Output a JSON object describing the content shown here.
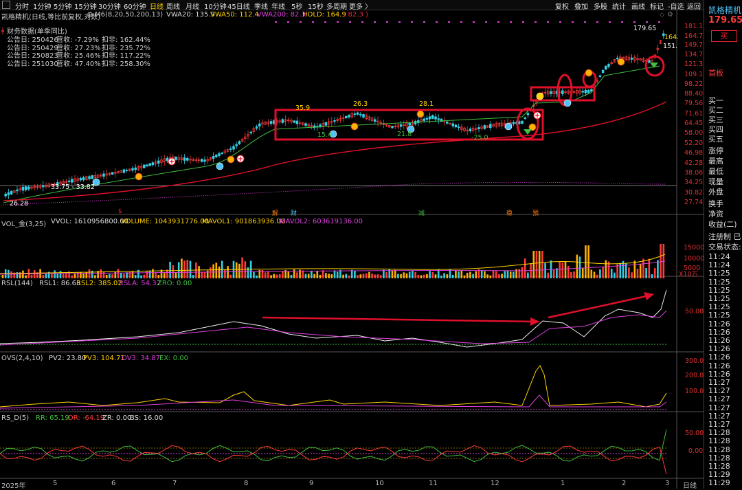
{
  "toolbar": {
    "timeframes": [
      "分时",
      "1分钟",
      "5分钟",
      "15分钟",
      "30分钟",
      "60分钟",
      "日线",
      "周线",
      "月线",
      "10分钟",
      "45日线",
      "季线",
      "年线",
      "5秒",
      "15秒",
      "多周期",
      "更多 〉"
    ],
    "tools": [
      "复权",
      "叠加",
      "多股",
      "统计",
      "画线",
      "标记",
      "-自选",
      "返回"
    ],
    "icons": [
      "diamond-icon",
      "gear-icon",
      "close-icon"
    ]
  },
  "stock": {
    "name": "凯格精机",
    "price": "179.65",
    "buy": "买",
    "banner": "首板"
  },
  "price_header": {
    "title": "凯格精机(日线,等比前复权,对数)",
    "ma": "M6(8,20,50,200,13)",
    "vwa20": "VWA20: 135.9",
    "vwa50": "VWA50: 112.4",
    "vwa200": "VWA200: 82.3",
    "hold": "HOLD: 164.9",
    "hold2": ": 82.3 )"
  },
  "financial": {
    "title": "财务数据(单季同比)",
    "rows": [
      {
        "date": "公告日: 250426",
        "rev": "营收:  -7.29%",
        "ded": "扣非:  162.44%"
      },
      {
        "date": "公告日: 250429",
        "rev": "营收:  27.23%",
        "ded": "扣非:  235.72%"
      },
      {
        "date": "公告日: 250823",
        "rev": "营收:  25.46%",
        "ded": "扣非:  117.22%"
      },
      {
        "date": "公告日: 251030",
        "rev": "营收:  47.40%",
        "ded": "扣非:  258.30%"
      }
    ]
  },
  "price_axis": [
    "181.1",
    "164.7",
    "149.7",
    "134.7",
    "121.3",
    "109.1",
    "98.22",
    "88.40",
    "79.56",
    "71.61",
    "64.45",
    "58.00",
    "52.20",
    "46.98",
    "42.28",
    "38.06",
    "34.25",
    "30.82",
    "27.74"
  ],
  "price_marks": {
    "high": "179.65",
    "low": "26.28",
    "range": "33.75 - 33.82",
    "p1": "35.9",
    "p2": "26.3",
    "p3": "28.1",
    "p4": "15.4",
    "p5": "21.8",
    "p6": "-25.0",
    "r1": "164.",
    "r2": "151."
  },
  "event_marks": [
    "$",
    "解",
    "财",
    "减",
    "稳",
    "预"
  ],
  "volume": {
    "title": "VOL_金(3,25)",
    "vvol": "VVOL: 1610956800.00",
    "volume": "VOLUME: 1043931776.00",
    "mavol1": "MAVOL1: 901863936.00",
    "mavol2": "MAVOL2: 603619136.00",
    "axis": [
      "15000",
      "10000",
      "5000"
    ],
    "unit": "X10万"
  },
  "rsl": {
    "title": "RSL(144)",
    "rsl1": "RSL1: 86.63",
    "rsl2": "RSL2: 385.02",
    "rsla": "RSLA: 54.32",
    "zro": "ZRO: 0.00",
    "axis": "50.00"
  },
  "ovs": {
    "title": "OVS(2,4,10)",
    "pv2": "PV2: 23.80",
    "pv3": "PV3: 104.71",
    "ov3": "OV3: 34.87",
    "ex": "EX: 0.00",
    "axis": [
      "300.0",
      "200.0",
      "100.0"
    ]
  },
  "rsd": {
    "title": "RS_D(5)",
    "rr": "RR: 65.19",
    "dr": "DR: -64.19",
    "zr": "ZR: 0.00",
    "bs": "BS: 16.00",
    "axis": [
      "50.00",
      "0.00"
    ]
  },
  "months": [
    "2025年",
    "5",
    "6",
    "7",
    "8",
    "9",
    "10",
    "11",
    "12",
    "1",
    "2",
    "3"
  ],
  "period_label": "日线",
  "order_book": [
    "买一",
    "买二",
    "买三",
    "买四",
    "买五",
    "涨停",
    "最高",
    "最低",
    "现量",
    "外盘",
    "换手",
    "净资",
    "收益(二)",
    "注册制  已",
    "交易状态:"
  ],
  "ticks": [
    "11:24",
    "11:24",
    "11:25",
    "11:25",
    "11:25",
    "11:25",
    "11:25",
    "11:25",
    "11:26",
    "11:26",
    "11:26",
    "11:26",
    "11:26",
    "11:26",
    "11:26",
    "11:27",
    "11:27",
    "11:27",
    "11:27",
    "11:27",
    "11:27",
    "11:28",
    "11:28",
    "11:28",
    "11:28",
    "11:28",
    "11:29",
    "11:29"
  ],
  "colors": {
    "up": "#ff3b3b",
    "down": "#34d0e6",
    "ma_green": "#3fbf3f",
    "ma_red": "#e0102a",
    "magenta": "#e040e0",
    "accent": "#ffd200"
  }
}
